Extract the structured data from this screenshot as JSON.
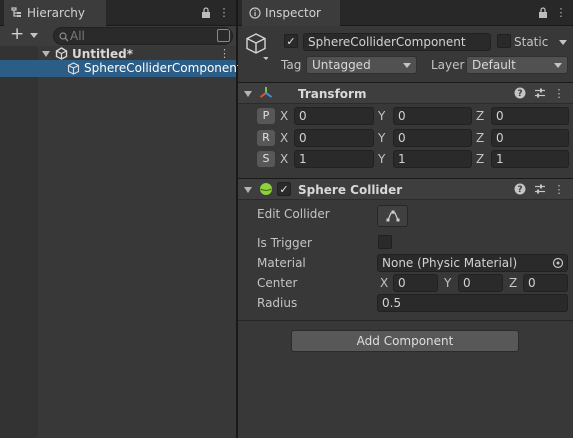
{
  "hierarchy": {
    "tab_label": "Hierarchy",
    "search_placeholder": "All",
    "scene_name": "Untitled*",
    "items": [
      {
        "label": "SphereColliderComponent",
        "selected": true
      }
    ]
  },
  "inspector": {
    "tab_label": "Inspector",
    "object_name": "SphereColliderComponent",
    "active_checked": true,
    "static_label": "Static",
    "tag_label": "Tag",
    "tag_value": "Untagged",
    "layer_label": "Layer",
    "layer_value": "Default",
    "transform": {
      "title": "Transform",
      "rows": [
        {
          "button": "P",
          "x": "0",
          "y": "0",
          "z": "0"
        },
        {
          "button": "R",
          "x": "0",
          "y": "0",
          "z": "0"
        },
        {
          "button": "S",
          "x": "1",
          "y": "1",
          "z": "1"
        }
      ],
      "axes": {
        "x": "X",
        "y": "Y",
        "z": "Z"
      }
    },
    "sphere_collider": {
      "title": "Sphere Collider",
      "enabled": true,
      "edit_collider_label": "Edit Collider",
      "is_trigger_label": "Is Trigger",
      "is_trigger": false,
      "material_label": "Material",
      "material_value": "None (Physic Material)",
      "center_label": "Center",
      "center": {
        "x": "0",
        "y": "0",
        "z": "0"
      },
      "radius_label": "Radius",
      "radius_value": "0.5"
    },
    "add_component_label": "Add Component"
  },
  "icons": [
    "hierarchy-icon",
    "lock-icon",
    "kebab-menu-icon",
    "plus-icon",
    "search-icon",
    "unity-logo-icon",
    "cube-icon",
    "info-icon",
    "help-icon",
    "presets-icon",
    "transform-icon",
    "sphere-collider-icon",
    "edit-collider-icon",
    "object-picker-icon"
  ],
  "colors": {
    "selection": "#2c5d87",
    "panel_bg": "#383838",
    "tab_bar": "#282828",
    "field_bg": "#2a2a2a"
  }
}
